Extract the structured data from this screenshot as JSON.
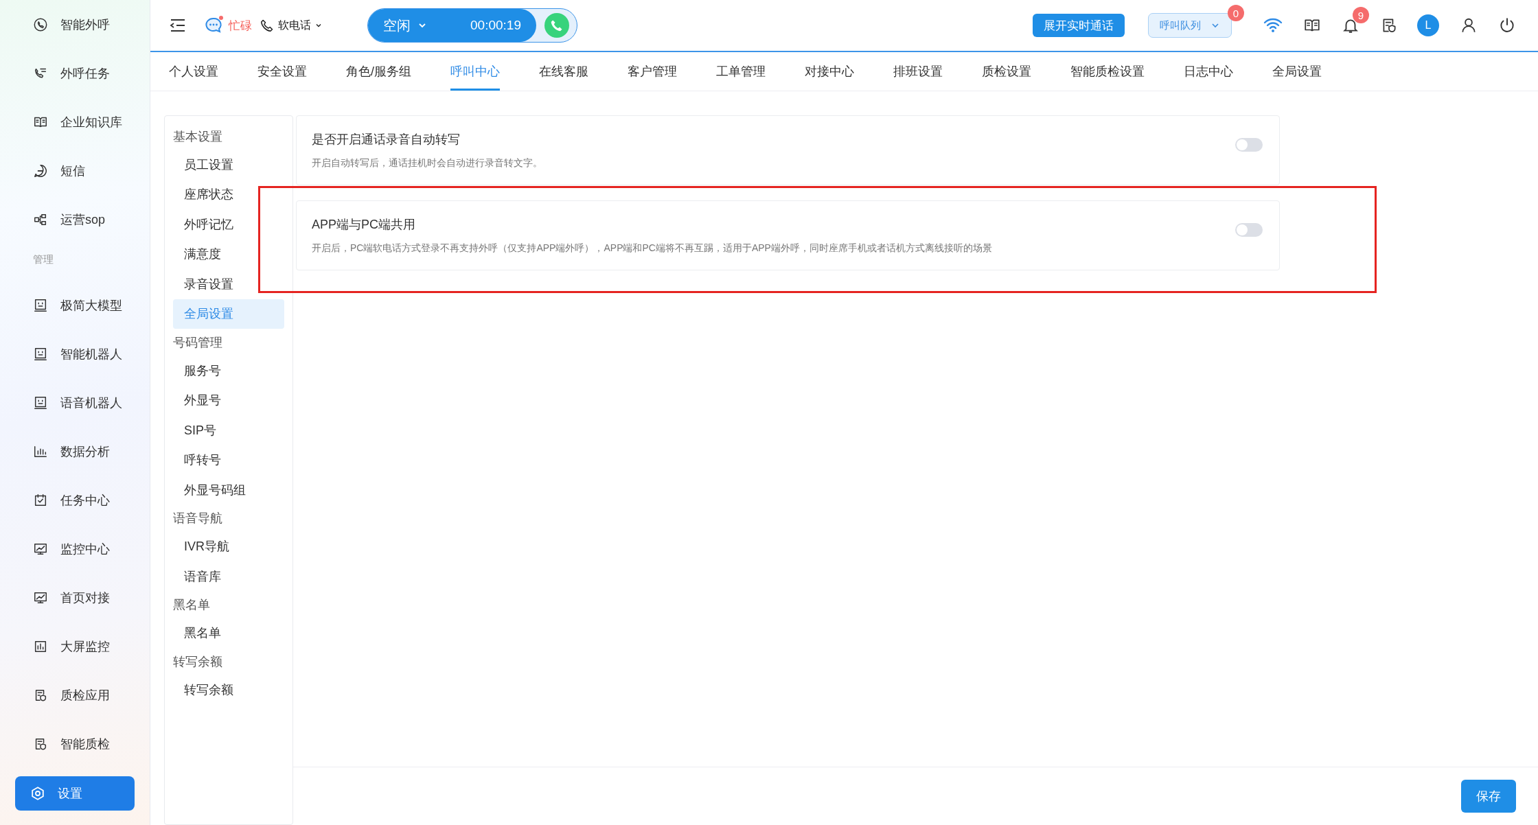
{
  "nav": [
    {
      "kind": "item",
      "label": "智能外呼",
      "selected": false
    },
    {
      "kind": "item",
      "label": "外呼任务",
      "selected": false
    },
    {
      "kind": "item",
      "label": "企业知识库",
      "selected": false
    },
    {
      "kind": "item",
      "label": "短信",
      "selected": false
    },
    {
      "kind": "item",
      "label": "运营sop",
      "selected": false
    },
    {
      "kind": "heading",
      "label": "管理"
    },
    {
      "kind": "item",
      "label": "极简大模型",
      "selected": false
    },
    {
      "kind": "item",
      "label": "智能机器人",
      "selected": false
    },
    {
      "kind": "item",
      "label": "语音机器人",
      "selected": false
    },
    {
      "kind": "item",
      "label": "数据分析",
      "selected": false
    },
    {
      "kind": "item",
      "label": "任务中心",
      "selected": false
    },
    {
      "kind": "item",
      "label": "监控中心",
      "selected": false
    },
    {
      "kind": "item",
      "label": "首页对接",
      "selected": false
    },
    {
      "kind": "item",
      "label": "大屏监控",
      "selected": false
    },
    {
      "kind": "item",
      "label": "质检应用",
      "selected": false
    },
    {
      "kind": "item",
      "label": "智能质检",
      "selected": false
    },
    {
      "kind": "item",
      "label": "设置",
      "selected": true
    }
  ],
  "topbar": {
    "status_text": "忙碌",
    "phone_mode": "软电话",
    "agent_state": "空闲",
    "timer": "00:00:19",
    "live_call_button": "展开实时通话",
    "queue": {
      "label": "呼叫队列",
      "badge": "0"
    },
    "notifications_badge": "9",
    "avatar": "L"
  },
  "tabs": [
    {
      "label": "个人设置",
      "selected": false
    },
    {
      "label": "安全设置",
      "selected": false
    },
    {
      "label": "角色/服务组",
      "selected": false
    },
    {
      "label": "呼叫中心",
      "selected": true
    },
    {
      "label": "在线客服",
      "selected": false
    },
    {
      "label": "客户管理",
      "selected": false
    },
    {
      "label": "工单管理",
      "selected": false
    },
    {
      "label": "对接中心",
      "selected": false
    },
    {
      "label": "排班设置",
      "selected": false
    },
    {
      "label": "质检设置",
      "selected": false
    },
    {
      "label": "智能质检设置",
      "selected": false
    },
    {
      "label": "日志中心",
      "selected": false
    },
    {
      "label": "全局设置",
      "selected": false
    }
  ],
  "submenu": [
    {
      "label": "基本设置",
      "children": [
        {
          "label": "员工设置",
          "selected": false
        },
        {
          "label": "座席状态",
          "selected": false
        },
        {
          "label": "外呼记忆",
          "selected": false
        },
        {
          "label": "满意度",
          "selected": false
        },
        {
          "label": "录音设置",
          "selected": false
        },
        {
          "label": "全局设置",
          "selected": true
        }
      ]
    },
    {
      "label": "号码管理",
      "children": [
        {
          "label": "服务号",
          "selected": false
        },
        {
          "label": "外显号",
          "selected": false
        },
        {
          "label": "SIP号",
          "selected": false
        },
        {
          "label": "呼转号",
          "selected": false
        },
        {
          "label": "外显号码组",
          "selected": false
        }
      ]
    },
    {
      "label": "语音导航",
      "children": [
        {
          "label": "IVR导航",
          "selected": false
        },
        {
          "label": "语音库",
          "selected": false
        }
      ]
    },
    {
      "label": "黑名单",
      "children": [
        {
          "label": "黑名单",
          "selected": false
        }
      ]
    },
    {
      "label": "转写余额",
      "children": [
        {
          "label": "转写余额",
          "selected": false
        }
      ]
    }
  ],
  "settings": [
    {
      "title": "是否开启通话录音自动转写",
      "description": "开启自动转写后，通话挂机时会自动进行录音转文字。",
      "on": false,
      "highlighted": false
    },
    {
      "title": "APP端与PC端共用",
      "description": "开启后，PC端软电话方式登录不再支持外呼（仅支持APP端外呼），APP端和PC端将不再互踢，适用于APP端外呼，同时座席手机或者话机方式离线接听的场景",
      "on": false,
      "highlighted": true
    }
  ],
  "save_button": "保存"
}
